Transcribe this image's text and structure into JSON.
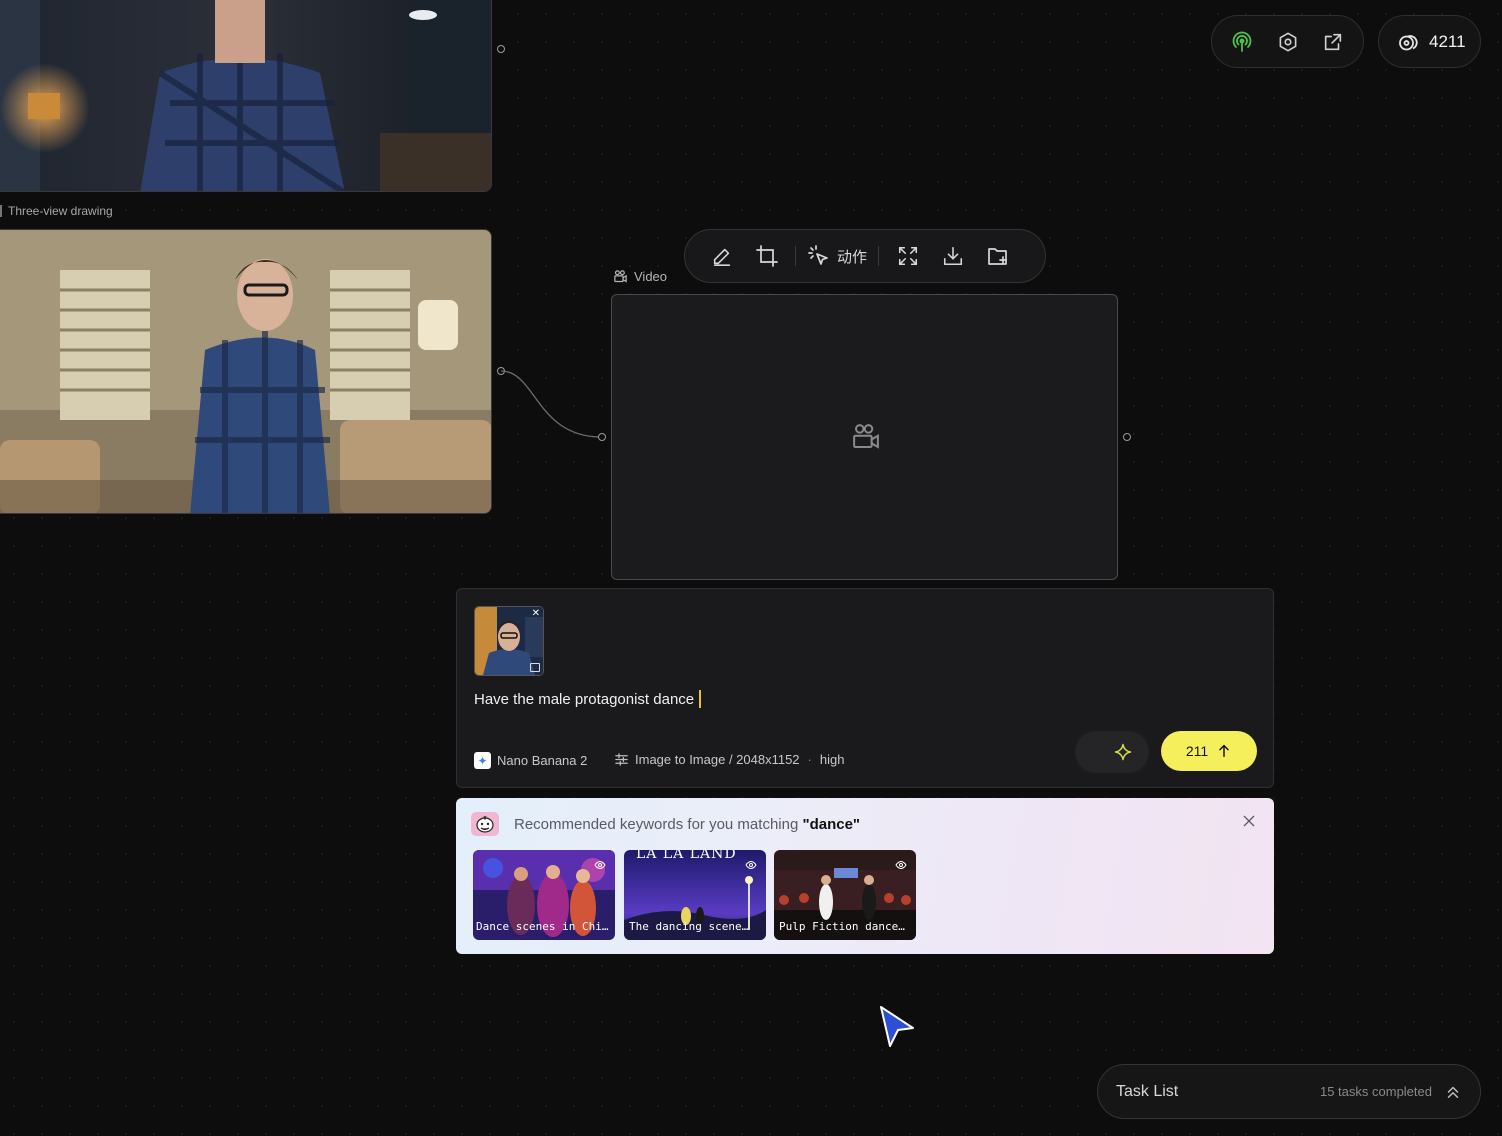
{
  "topbar": {
    "credits": "4211",
    "icons": [
      "broadcast-icon",
      "settings-hex-icon",
      "external-link-icon",
      "coins-icon"
    ],
    "accent_color": "#4cc24a"
  },
  "nodes": {
    "three_view_label": "Three-view drawing",
    "video_label": "Video"
  },
  "toolbar": {
    "action_label": "动作",
    "icons": [
      "edit-icon",
      "crop-icon",
      "select-action-icon",
      "expand-icon",
      "download-icon",
      "folder-add-icon"
    ]
  },
  "prompt": {
    "text": "Have the male protagonist dance",
    "model": "Nano Banana 2",
    "settings": "Image to Image / 2048x1152",
    "quality": "high",
    "submit_cost": "211",
    "submit_color": "#f4ef5a"
  },
  "recommend": {
    "prefix": "Recommended keywords for you matching ",
    "keyword": "\"dance\"",
    "items": [
      {
        "caption": "Dance scenes in Chi…"
      },
      {
        "caption": "The dancing scene…",
        "overlay_text": "LA LA LAND"
      },
      {
        "caption": "Pulp Fiction dance…"
      }
    ]
  },
  "task_list": {
    "title": "Task List",
    "status": "15 tasks completed"
  }
}
